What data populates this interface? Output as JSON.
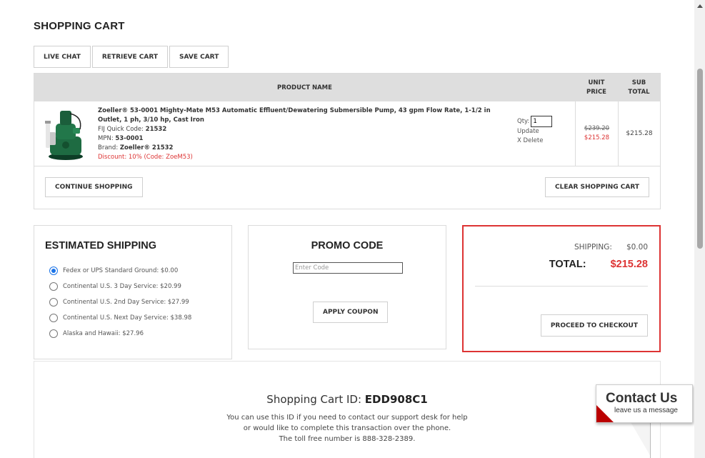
{
  "page": {
    "title": "SHOPPING CART"
  },
  "top_actions": {
    "live_chat": "LIVE CHAT",
    "retrieve_cart": "RETRIEVE CART",
    "save_cart": "SAVE CART"
  },
  "table": {
    "headers": {
      "product_name": "PRODUCT NAME",
      "unit_price_1": "UNIT",
      "unit_price_2": "PRICE",
      "sub_total_1": "SUB",
      "sub_total_2": "TOTAL"
    }
  },
  "item": {
    "title": "Zoeller® 53-0001 Mighty-Mate M53 Automatic Effluent/Dewatering Submersible Pump, 43 gpm Flow Rate, 1-1/2 in Outlet, 1 ph, 3/10 hp, Cast Iron",
    "quick_code_label": "FIJ Quick Code: ",
    "quick_code": "21532",
    "mpn_label": "MPN: ",
    "mpn": "53-0001",
    "brand_label": "Brand: ",
    "brand": "Zoeller® 21532",
    "discount": "Discount: 10% (Code: ZoeM53)",
    "qty_label": "Qty:",
    "qty_value": "1",
    "update": "Update",
    "delete": "X Delete",
    "old_price": "$239.20",
    "unit_price": "$215.28",
    "sub_total": "$215.28",
    "image_icon": "pump-image-icon"
  },
  "cart_actions": {
    "continue": "CONTINUE SHOPPING",
    "clear": "CLEAR SHOPPING CART"
  },
  "shipping": {
    "title": "ESTIMATED SHIPPING",
    "options": [
      {
        "label": "Fedex or UPS Standard Ground: $0.00",
        "selected": true
      },
      {
        "label": "Continental U.S. 3 Day Service: $20.99",
        "selected": false
      },
      {
        "label": "Continental U.S. 2nd Day Service: $27.99",
        "selected": false
      },
      {
        "label": "Continental U.S. Next Day Service: $38.98",
        "selected": false
      },
      {
        "label": "Alaska and Hawaii: $27.96",
        "selected": false
      }
    ]
  },
  "promo": {
    "title": "PROMO CODE",
    "placeholder": "Enter Code",
    "apply": "APPLY COUPON"
  },
  "totals": {
    "shipping_label": "SHIPPING:",
    "shipping_value": "$0.00",
    "total_label": "TOTAL:",
    "total_value": "$215.28",
    "checkout": "PROCEED TO CHECKOUT",
    "accent_color": "#d33333"
  },
  "cart_id": {
    "label": "Shopping Cart ID: ",
    "value": "EDD908C1",
    "desc_1": "You can use this ID if you need to contact our support desk for help",
    "desc_2": "or would like to complete this transaction over the phone.",
    "desc_3": "The toll free number is 888-328-2389."
  },
  "contact_widget": {
    "title": "Contact Us",
    "subtitle": "leave us a message"
  }
}
